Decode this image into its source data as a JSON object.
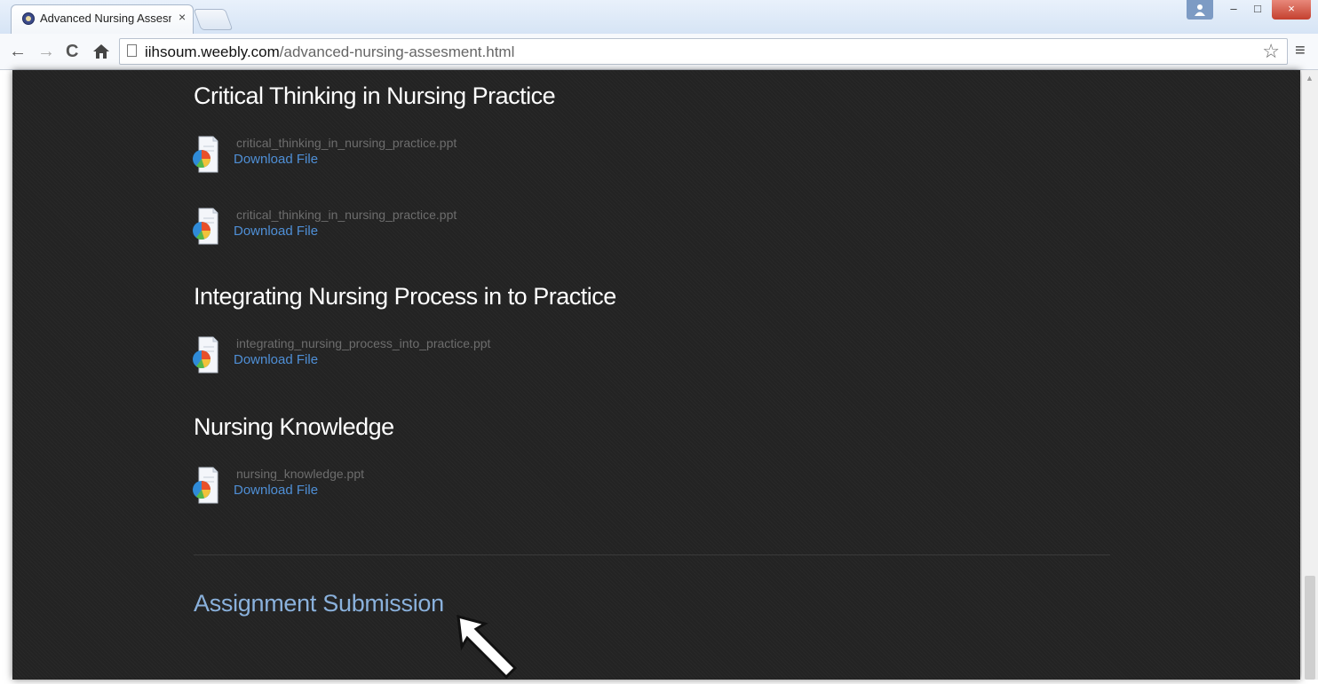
{
  "browser": {
    "tab_title": "Advanced Nursing Assesm",
    "tab_close": "×",
    "url_host": "iihsoum.weebly.com",
    "url_path": "/advanced-nursing-assesment.html",
    "nav": {
      "back": "←",
      "forward": "→",
      "reload": "C",
      "home": "🏠"
    },
    "window_buttons": {
      "minimize": "–",
      "maximize": "□",
      "close": "×"
    },
    "star": "☆",
    "menu": "≡"
  },
  "sections": [
    {
      "title": "Critical Thinking in Nursing Practice",
      "files": [
        {
          "name": "critical_thinking_in_nursing_practice.ppt",
          "link": "Download File"
        },
        {
          "name": "critical_thinking_in_nursing_practice.ppt",
          "link": "Download File"
        }
      ]
    },
    {
      "title": "Integrating Nursing Process in to Practice",
      "files": [
        {
          "name": "integrating_nursing_process_into_practice.ppt",
          "link": "Download File"
        }
      ]
    },
    {
      "title": "Nursing Knowledge",
      "files": [
        {
          "name": "nursing_knowledge.ppt",
          "link": "Download File"
        }
      ]
    }
  ],
  "assignment_link": "Assignment Submission",
  "colors": {
    "page_background": "#232323",
    "heading": "#ffffff",
    "file_name": "#6d6d6d",
    "download_link": "#4f8fd6",
    "assignment_link": "#8ab1dc"
  }
}
